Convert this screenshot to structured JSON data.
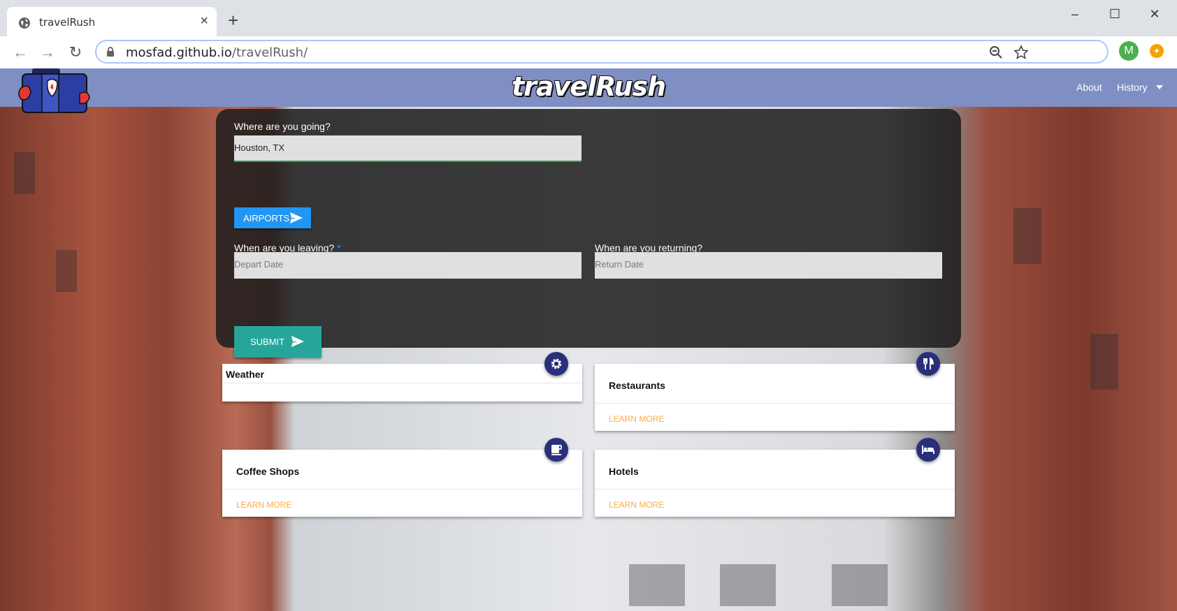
{
  "browser": {
    "tab_title": "travelRush",
    "tab_close": "×",
    "new_tab": "+",
    "url_host": "mosfad.github.io",
    "url_path": "/travelRush/",
    "profile_initial": "M",
    "window_controls": {
      "minimize": "–",
      "maximize": "☐",
      "close": "✕"
    }
  },
  "nav": {
    "brand": "travelRush",
    "links": [
      "About",
      "History"
    ]
  },
  "search": {
    "destination_label": "Where are you going?",
    "destination_value": "Houston, TX",
    "airports_button": "AIRPORTS",
    "leaving_label": "When are you leaving?",
    "required_mark": "*",
    "depart_placeholder": "Depart Date",
    "returning_label": "When are you returning?",
    "return_placeholder": "Return Date",
    "submit_button": "SUBMIT"
  },
  "cards": [
    {
      "title": "Weather",
      "icon": "gear-icon"
    },
    {
      "title": "Restaurants",
      "link": "LEARN MORE",
      "icon": "restaurant-icon"
    },
    {
      "title": "Coffee Shops",
      "link": "LEARN MORE",
      "icon": "coffee-icon"
    },
    {
      "title": "Hotels",
      "link": "LEARN MORE",
      "icon": "hotel-icon"
    }
  ],
  "colors": {
    "nav_bg": "#7f8fc4",
    "airports_button": "#2196f3",
    "submit_button": "#26a69a",
    "fab": "#2a2f7c",
    "learn_more": "#ffab40"
  }
}
